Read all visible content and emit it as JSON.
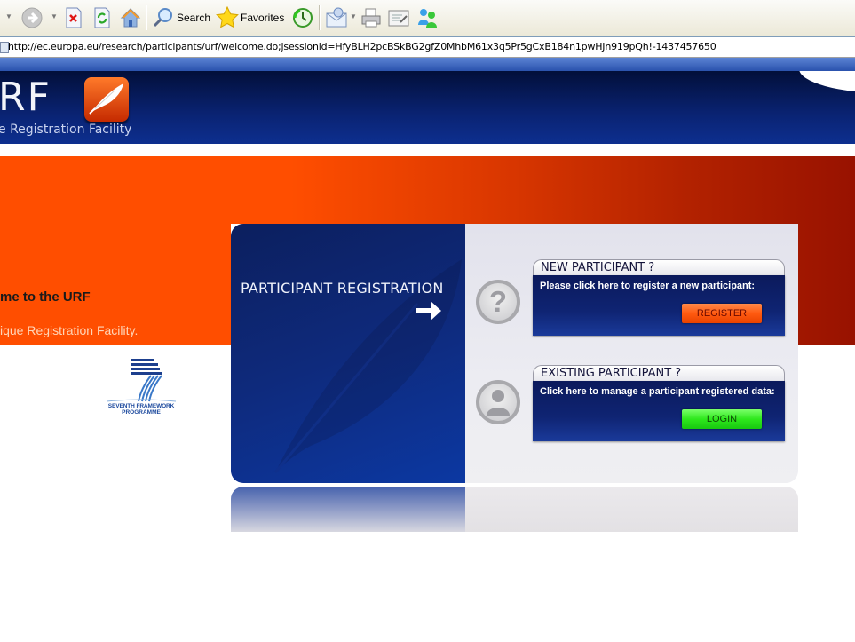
{
  "browser": {
    "toolbar": {
      "search_label": "Search",
      "favorites_label": "Favorites",
      "icons": [
        "back-dropdown-icon",
        "forward-icon",
        "stop-icon",
        "refresh-icon",
        "home-icon",
        "search-icon",
        "favorites-star-icon",
        "history-icon",
        "mail-icon",
        "print-icon",
        "edit-icon",
        "messenger-icon"
      ]
    },
    "address": {
      "url": "http://ec.europa.eu/research/participants/urf/welcome.do;jsessionid=HfyBLH2pcBSkBG2gfZ0MhbM61x3q5Pr5gCxB184n1pwHJn919pQh!-1437457650"
    }
  },
  "header": {
    "logo_text": "RF",
    "logo_subtitle": "e Registration Facility"
  },
  "welcome": {
    "title": "me to the URF",
    "subtitle": "ique Registration Facility."
  },
  "fp7": {
    "line1": "SEVENTH FRAMEWORK",
    "line2": "PROGRAMME"
  },
  "panel": {
    "left_title": "PARTICIPANT REGISTRATION",
    "new_participant": {
      "heading": "NEW PARTICIPANT ?",
      "text": "Please click here to register a new participant:",
      "button": "REGISTER"
    },
    "existing_participant": {
      "heading": "EXISTING PARTICIPANT ?",
      "text": "Click here to manage a participant registered data:",
      "button": "LOGIN"
    }
  },
  "colors": {
    "header_blue": "#0a2373",
    "band_orange": "#ff4e00",
    "band_dark_red": "#981200",
    "register_orange": "#ff5a10",
    "login_green": "#2ee81c"
  }
}
